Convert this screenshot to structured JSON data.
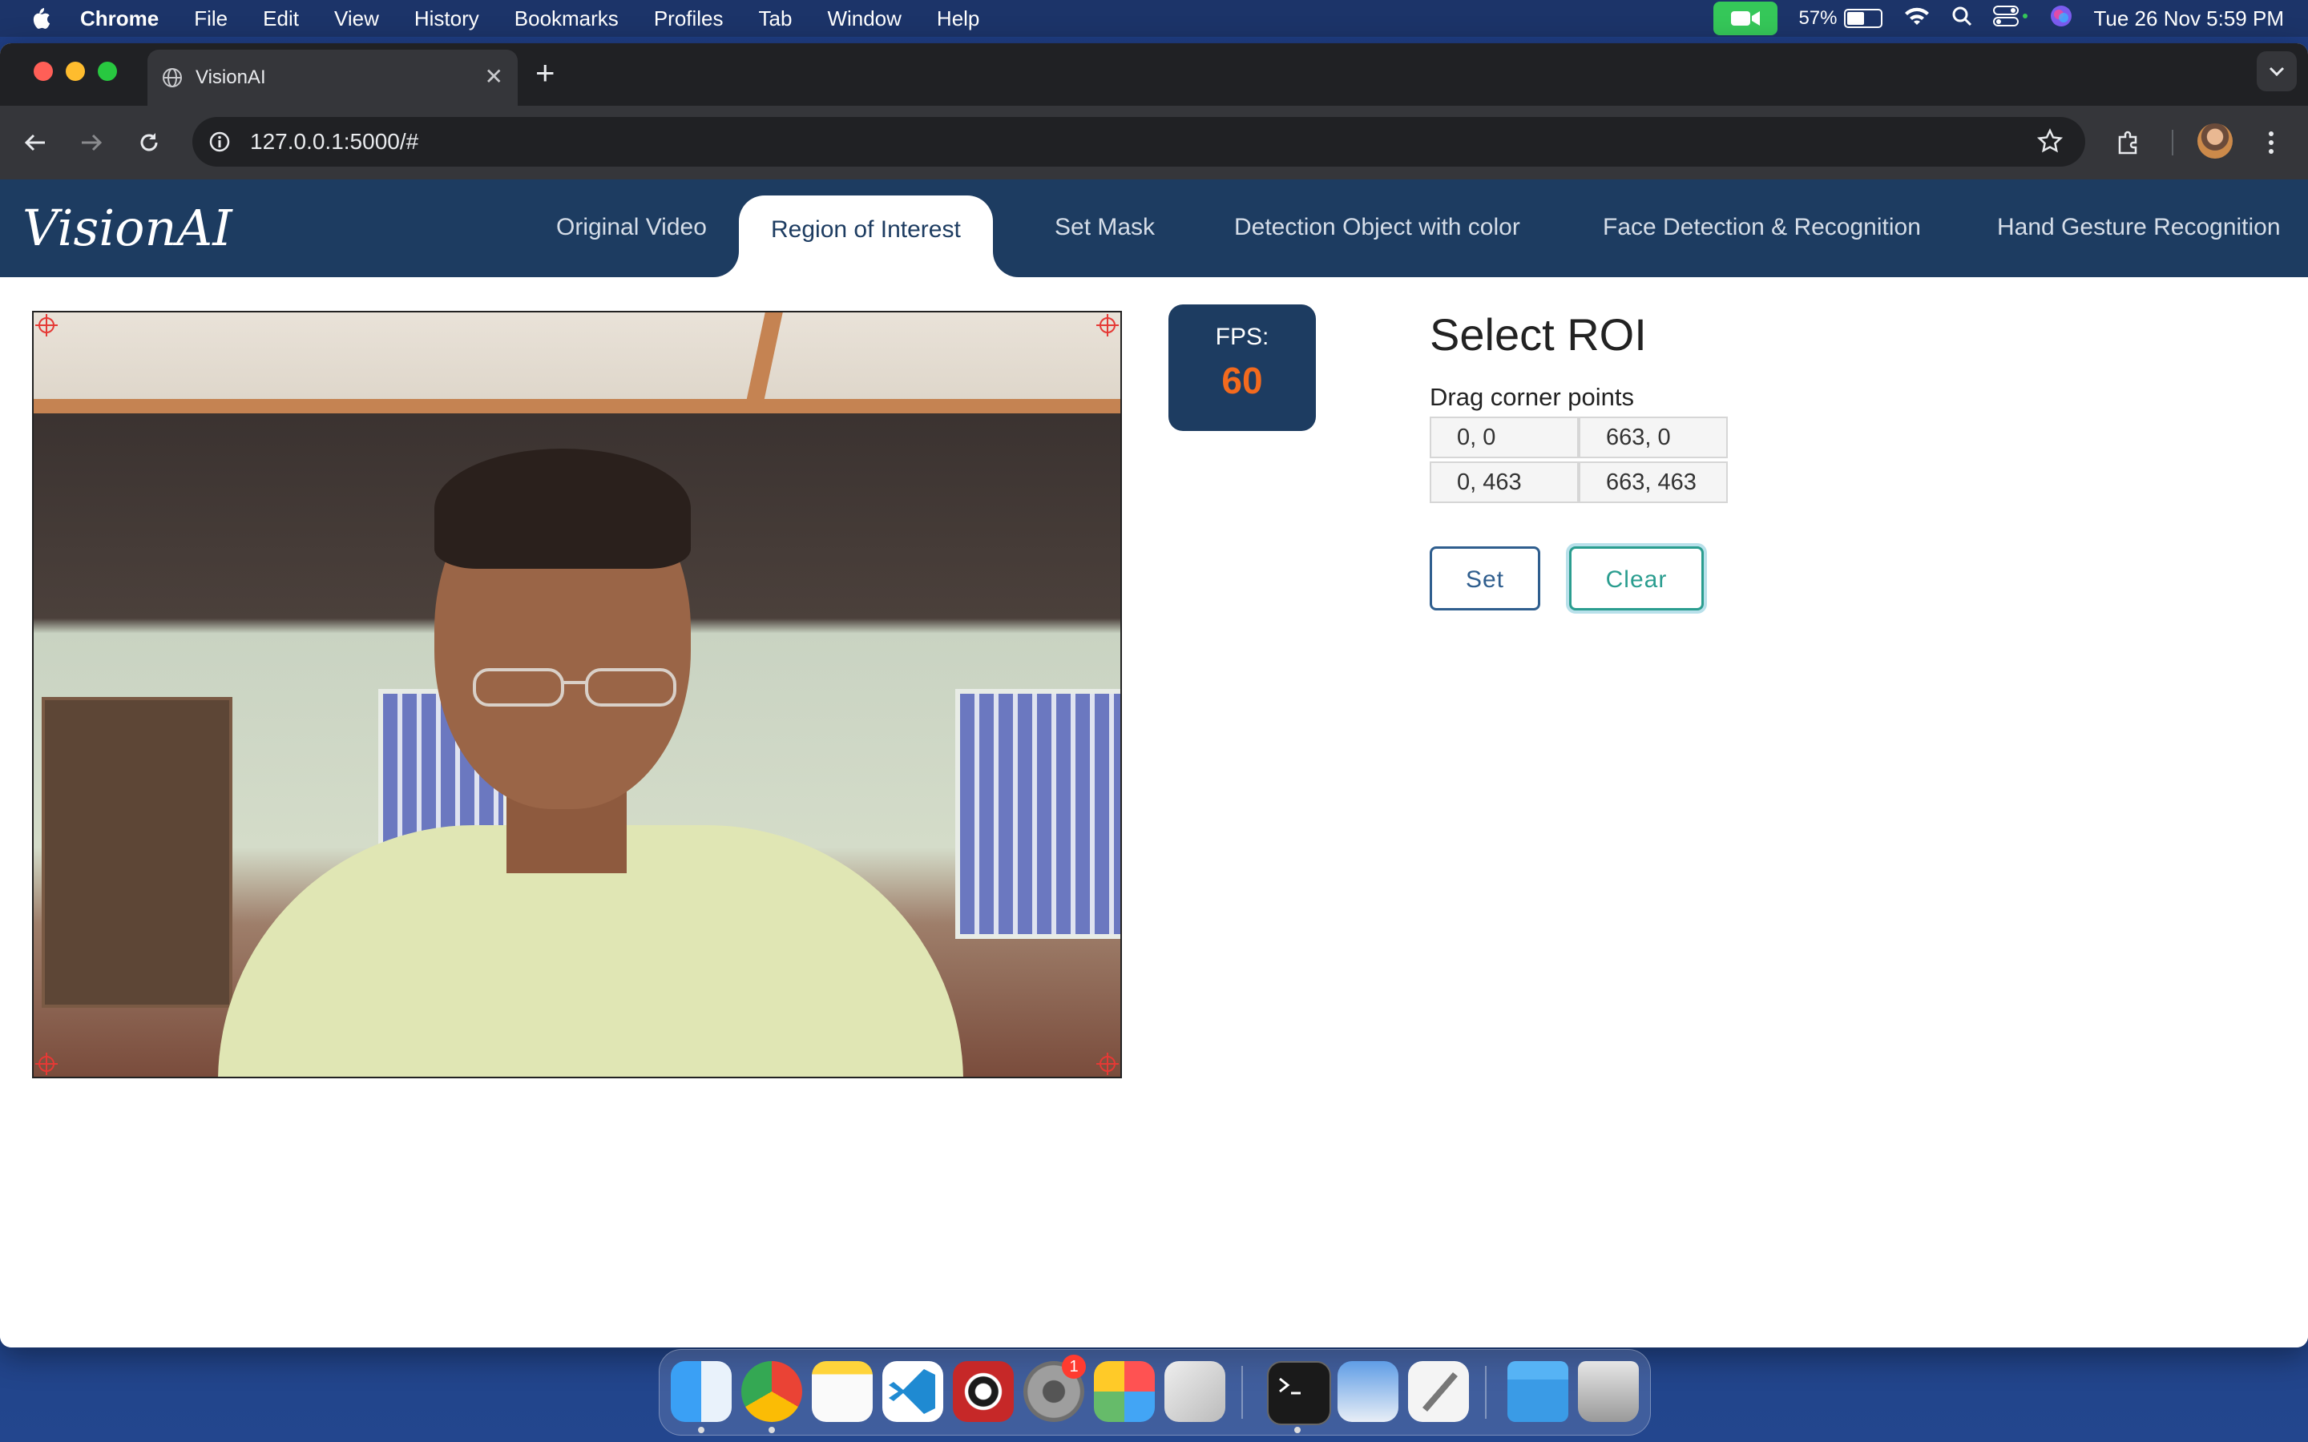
{
  "menubar": {
    "app": "Chrome",
    "items": [
      "File",
      "Edit",
      "View",
      "History",
      "Bookmarks",
      "Profiles",
      "Tab",
      "Window",
      "Help"
    ],
    "battery_percent": "57%",
    "battery_level": 0.57,
    "datetime": "Tue 26 Nov  5:59 PM"
  },
  "browser": {
    "tab_title": "VisionAI",
    "url": "127.0.0.1:5000/#"
  },
  "app": {
    "brand": "VisionAI",
    "nav": [
      {
        "label": "Original Video"
      },
      {
        "label": "Region of Interest",
        "active": true
      },
      {
        "label": "Set Mask"
      },
      {
        "label": "Detection Object with color"
      },
      {
        "label": "Face Detection & Recognition"
      },
      {
        "label": "Hand Gesture Recognition"
      }
    ],
    "fps": {
      "label": "FPS:",
      "value": "60"
    },
    "roi": {
      "title": "Select ROI",
      "subtitle": "Drag corner points",
      "points": {
        "top_left": "0, 0",
        "top_right": "663, 0",
        "bottom_left": "0, 463",
        "bottom_right": "663, 463"
      },
      "set_label": "Set",
      "clear_label": "Clear"
    }
  },
  "dock": {
    "apps": [
      "Finder",
      "Chrome",
      "Notes",
      "VS Code",
      "Photo Booth",
      "System Settings",
      "Launchpad",
      "iPhone Mirroring",
      "Terminal",
      "Preview",
      "TextEdit",
      "Folder",
      "Trash"
    ],
    "settings_badge": "1"
  },
  "colors": {
    "navbar": "#1d3c61",
    "fps_value": "#f36a1e",
    "set_button": "#2f5e8e",
    "clear_button": "#2a9d8f"
  }
}
